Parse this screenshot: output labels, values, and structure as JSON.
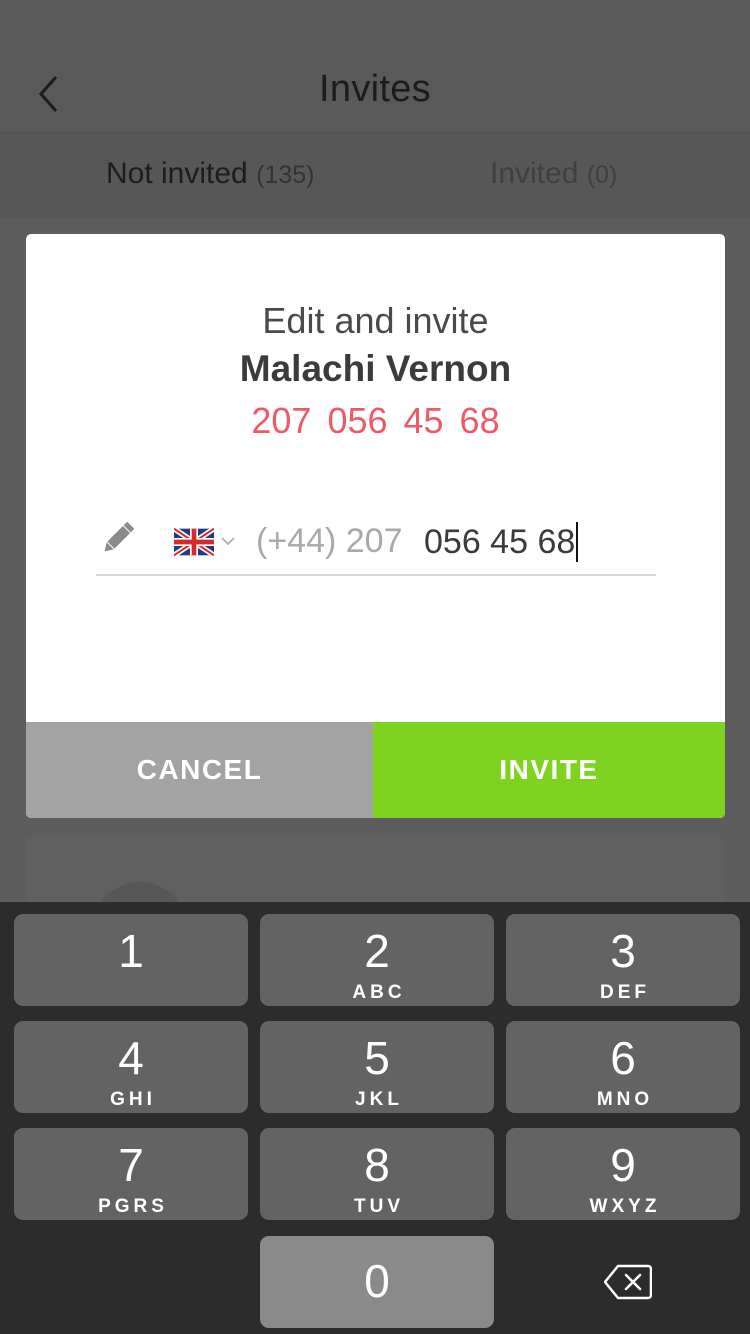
{
  "header": {
    "title": "Invites",
    "back_icon": "chevron-left-icon"
  },
  "tabs": [
    {
      "label": "Not invited",
      "count": "(135)"
    },
    {
      "label": "Invited",
      "count": "(0)"
    }
  ],
  "dialog": {
    "heading": "Edit and invite",
    "contact_name": "Malachi Vernon",
    "contact_phone": "207  056 45 68",
    "phone_field": {
      "country_flag": "uk-flag-icon",
      "country_code_prefix": "(+44) 207",
      "value": "056 45 68"
    },
    "cancel_label": "CANCEL",
    "invite_label": "INVITE",
    "colors": {
      "phone_accent": "#ec5a66",
      "invite_button": "#7ed321",
      "cancel_button": "#a3a3a3"
    }
  },
  "keypad": {
    "keys": [
      {
        "digit": "1",
        "letters": ""
      },
      {
        "digit": "2",
        "letters": "ABC"
      },
      {
        "digit": "3",
        "letters": "DEF"
      },
      {
        "digit": "4",
        "letters": "GHI"
      },
      {
        "digit": "5",
        "letters": "JKL"
      },
      {
        "digit": "6",
        "letters": "MNO"
      },
      {
        "digit": "7",
        "letters": "PGRS"
      },
      {
        "digit": "8",
        "letters": "TUV"
      },
      {
        "digit": "9",
        "letters": "WXYZ"
      },
      {
        "digit": "0",
        "letters": ""
      }
    ],
    "delete_icon": "backspace-icon"
  }
}
